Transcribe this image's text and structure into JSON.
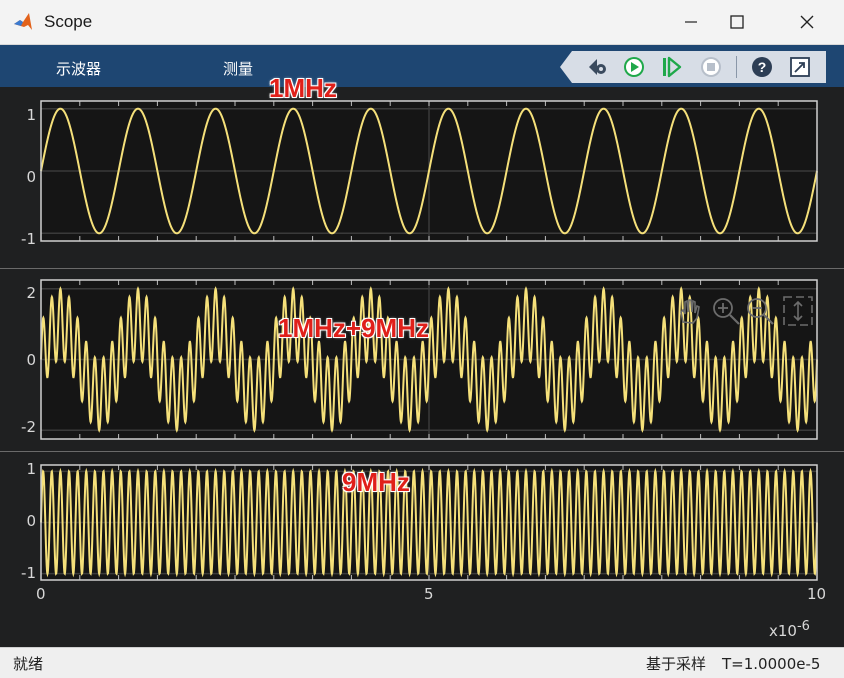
{
  "window": {
    "title": "Scope",
    "controls": [
      "minimize",
      "maximize",
      "close"
    ]
  },
  "toolbar": {
    "menu": [
      "示波器",
      "测量"
    ],
    "tools": [
      "settings-icon",
      "run-icon",
      "step-forward-icon",
      "stop-icon",
      "help-icon",
      "undock-icon"
    ]
  },
  "annotations": {
    "top": "1MHz",
    "middle": "1MHz+9MHz",
    "bottom": "9MHz"
  },
  "axes": {
    "y_ticks_top": [
      "1",
      "0",
      "-1"
    ],
    "y_ticks_middle": [
      "2",
      "0",
      "-2"
    ],
    "y_ticks_bottom": [
      "1",
      "0",
      "-1"
    ],
    "x_ticks": [
      "0",
      "5",
      "10"
    ],
    "x_multiplier_base": "x10",
    "x_multiplier_exp": "-6"
  },
  "status": {
    "left": "就绪",
    "mode": "基于采样",
    "time": "T=1.0000e-5"
  },
  "colors": {
    "signal": "#f5e07a",
    "plot_bg": "#151515",
    "frame_bg": "#1f2021",
    "toolbar": "#1e4672",
    "annotation": "#e0201a"
  },
  "chart_data": [
    {
      "type": "line",
      "title": "1MHz",
      "series": [
        {
          "frequency_hz": 1000000,
          "amplitude": 1
        }
      ],
      "xlim": [
        0,
        1e-05
      ],
      "ylim": [
        -1,
        1
      ],
      "grid": true
    },
    {
      "type": "line",
      "title": "1MHz+9MHz",
      "series": [
        {
          "components_hz": [
            1000000,
            9000000
          ],
          "amplitudes": [
            1,
            1
          ]
        }
      ],
      "xlim": [
        0,
        1e-05
      ],
      "ylim": [
        -2,
        2
      ],
      "grid": true
    },
    {
      "type": "line",
      "title": "9MHz",
      "series": [
        {
          "frequency_hz": 9000000,
          "amplitude": 1
        }
      ],
      "xlim": [
        0,
        1e-05
      ],
      "ylim": [
        -1,
        1
      ],
      "grid": true
    }
  ]
}
